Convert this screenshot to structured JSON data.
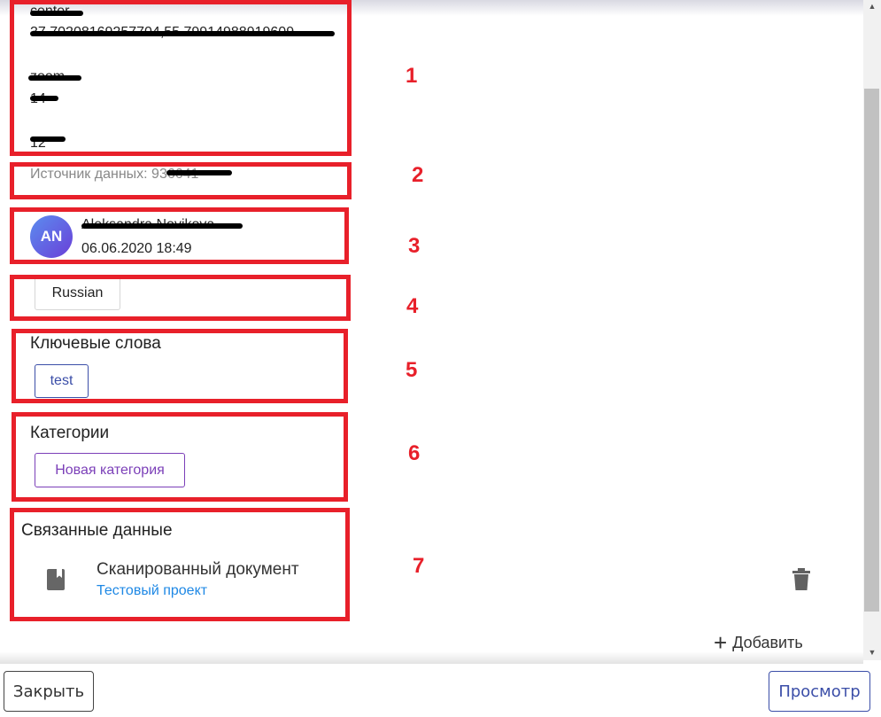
{
  "metadata": {
    "center_label": "center",
    "center_value": "37.70208169257704,55.79914988919609",
    "zoom_label": "zoom",
    "zoom_value": "14",
    "z_value": "12"
  },
  "source": {
    "label": "Источник данных: ",
    "value": "936641"
  },
  "author": {
    "initials": "AN",
    "name": "Aleksandra Novikova",
    "datetime": "06.06.2020 18:49"
  },
  "language": {
    "chip": "Russian"
  },
  "keywords": {
    "title": "Ключевые слова",
    "items": [
      "test"
    ]
  },
  "categories": {
    "title": "Категории",
    "add_chip": "Новая категория"
  },
  "related": {
    "title": "Связанные данные",
    "items": [
      {
        "name": "Сканированный документ",
        "project": "Тестовый проект"
      }
    ],
    "add_label": "Добавить"
  },
  "footer": {
    "close_label": "Закрыть",
    "view_label": "Просмотр"
  },
  "annotations": [
    "1",
    "2",
    "3",
    "4",
    "5",
    "6",
    "7"
  ],
  "colors": {
    "annotation": "#e8202a",
    "keyword_chip": "#3b4ea8",
    "category_chip": "#7b3fb8",
    "link": "#1e88e5",
    "avatar_start": "#5b8def",
    "avatar_end": "#6a3fd8"
  }
}
